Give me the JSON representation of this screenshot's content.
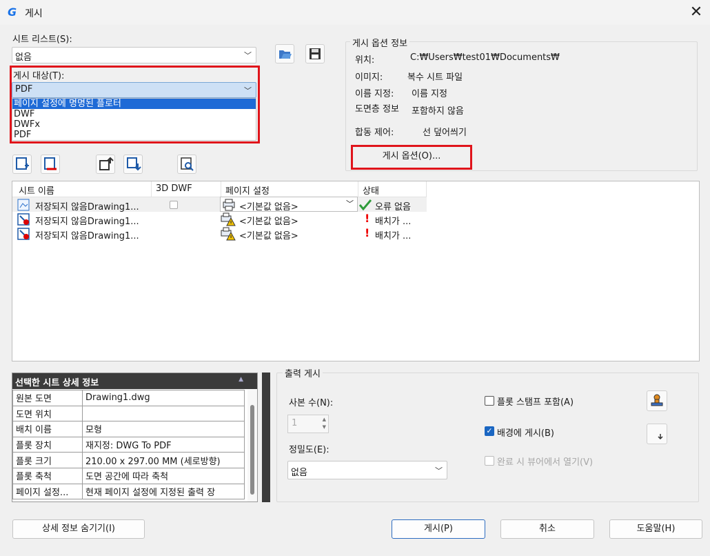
{
  "window": {
    "title": "게시",
    "close": "✕"
  },
  "sheet_list": {
    "label": "시트 리스트(S):",
    "value": "없음"
  },
  "publish_to": {
    "label": "게시 대상(T):",
    "value": "PDF",
    "options": [
      "페이지 설정에 명명된 플로터",
      "DWF",
      "DWFx",
      "PDF"
    ]
  },
  "options_info": {
    "title": "게시 옵션 정보",
    "rows": [
      {
        "label": "위치:",
        "value": "C:₩Users₩test01₩Documents₩"
      },
      {
        "label": "이미지:",
        "value": "복수 시트 파일"
      },
      {
        "label": "이름 지정:",
        "value": "이름 지정"
      },
      {
        "label": "도면층 정보",
        "value": "포함하지 않음"
      },
      {
        "label": "합동 제어:",
        "value": "선 덮어씌기"
      }
    ],
    "button": "게시 옵션(O)..."
  },
  "sheets": {
    "headers": [
      "시트 이름",
      "3D DWF",
      "페이지 설정",
      "상태"
    ],
    "rows": [
      {
        "name": "저장되지 않음Drawing1...",
        "page_setup": "<기본값 없음>",
        "status": "오류 없음"
      },
      {
        "name": "저장되지 않음Drawing1...",
        "page_setup": "<기본값 없음>",
        "status": "배치가 ..."
      },
      {
        "name": "저장되지 않음Drawing1...",
        "page_setup": "<기본값 없음>",
        "status": "배치가 ..."
      }
    ]
  },
  "details": {
    "title": "선택한 시트 상세 정보",
    "rows": [
      {
        "k": "원본 도면",
        "v": "Drawing1.dwg"
      },
      {
        "k": "도면 위치",
        "v": ""
      },
      {
        "k": "배치 이름",
        "v": "모형"
      },
      {
        "k": "플롯 장치",
        "v": "재지정: DWG To PDF"
      },
      {
        "k": "플롯 크기",
        "v": "210.00 x 297.00 MM (세로방향)"
      },
      {
        "k": "플롯 축척",
        "v": "도면 공간에 따라 축척"
      },
      {
        "k": "페이지 설정...",
        "v": "현재 페이지 설정에 지정된 출력 장"
      }
    ]
  },
  "output": {
    "title": "출력 게시",
    "copies_label": "사본 수(N):",
    "copies": "1",
    "precision_label": "정밀도(E):",
    "precision": "없음",
    "stamp": "플롯 스탬프 포함(A)",
    "background": "배경에 게시(B)",
    "viewer": "완료 시 뷰어에서 열기(V)"
  },
  "buttons": {
    "hide_details": "상세 정보 숨기기(I)",
    "publish": "게시(P)",
    "cancel": "취소",
    "help": "도움말(H)"
  }
}
